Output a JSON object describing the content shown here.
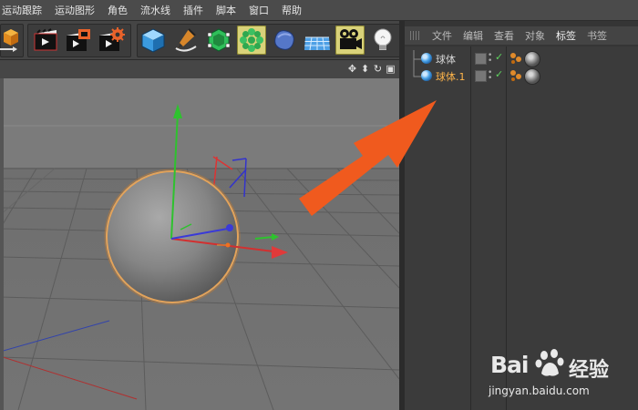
{
  "menu": {
    "items": [
      "运动跟踪",
      "运动图形",
      "角色",
      "流水线",
      "插件",
      "脚本",
      "窗口",
      "帮助"
    ]
  },
  "toolbar": {
    "buttons": [
      "cube-primitive-icon",
      "render-view-icon",
      "render-to-picture-viewer-icon",
      "render-settings-icon",
      "cube-icon",
      "pen-spline-icon",
      "subdivision-icon",
      "array-generator-icon",
      "deformer-icon",
      "floor-icon",
      "camera-icon",
      "light-icon"
    ]
  },
  "object_manager": {
    "tabs": [
      "文件",
      "编辑",
      "查看",
      "对象",
      "标签",
      "书签"
    ],
    "active_tab": "标签",
    "objects": [
      {
        "name": "球体",
        "selected": false
      },
      {
        "name": "球体.1",
        "selected": true
      }
    ]
  },
  "watermark": {
    "brand": "Bai",
    "brand_suffix": "经验",
    "url": "jingyan.baidu.com"
  },
  "colors": {
    "arrow": "#f05a1e",
    "selection": "#ffb54a",
    "check": "#5fd35f"
  }
}
